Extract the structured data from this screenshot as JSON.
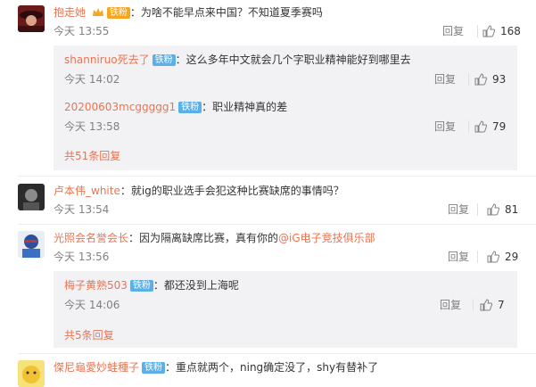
{
  "c1": {
    "user": "抱走她",
    "badge": "铁粉",
    "text": "：为啥不能早点来中国？不知道夏季赛吗",
    "time": "今天 13:55",
    "reply": "回复",
    "likes": "168",
    "subs": [
      {
        "user": "shanniruo死去了",
        "badge": "铁粉",
        "text": "：这么多年中文就会几个字职业精神能好到哪里去",
        "time": "今天 14:02",
        "reply": "回复",
        "likes": "93"
      },
      {
        "user": "20200603mcggggg1",
        "badge": "铁粉",
        "text": "：职业精神真的差",
        "time": "今天 13:58",
        "reply": "回复",
        "likes": "79"
      }
    ],
    "more": "共51条回复"
  },
  "c2": {
    "user": "卢本伟_white",
    "text": "：就ig的职业选手会犯这种比赛缺席的事情吗？",
    "time": "今天 13:54",
    "reply": "回复",
    "likes": "81"
  },
  "c3": {
    "user": "光照会名誉会长",
    "text": "：因为隔离缺席比赛，真有你的",
    "mention": "@iG电子竞技俱乐部",
    "time": "今天 13:56",
    "reply": "回复",
    "likes": "29",
    "subs": [
      {
        "user": "梅子黄熟503",
        "badge": "铁粉",
        "text": "：都还没到上海呢",
        "time": "今天 14:06",
        "reply": "回复",
        "likes": "7"
      }
    ],
    "more": "共5条回复"
  },
  "c4": {
    "user": "傑尼龜愛妙蛙種子",
    "badge": "铁粉",
    "text": "：重点就两个，ning确定没了，shy有替补了"
  },
  "colors": {
    "username": "#eb7350",
    "fan_badge": "#5bb0e8",
    "muted": "#808080",
    "sub_bg": "#f2f2f5"
  }
}
